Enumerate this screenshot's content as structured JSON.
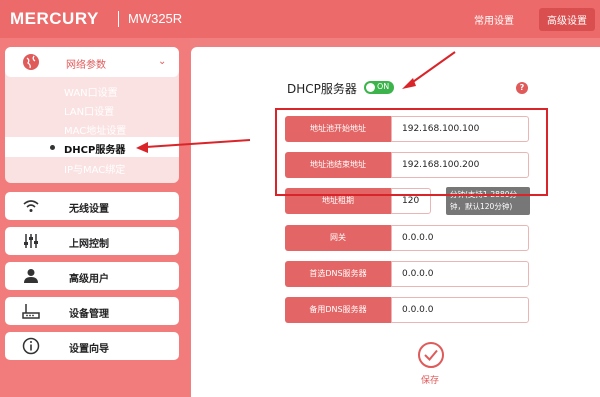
{
  "header": {
    "brand": "MERCURY",
    "model": "MW325R",
    "link_common": "常用设置",
    "link_advanced": "高级设置"
  },
  "sidebar": {
    "group": {
      "label": "网络参数",
      "icon": "globe-icon"
    },
    "sub_items": [
      "WAN口设置",
      "LAN口设置",
      "MAC地址设置",
      "DHCP服务器",
      "IP与MAC绑定"
    ],
    "active_sub": "DHCP服务器",
    "items": [
      {
        "label": "无线设置",
        "icon": "wifi-icon"
      },
      {
        "label": "上网控制",
        "icon": "sliders-icon"
      },
      {
        "label": "高级用户",
        "icon": "user-icon"
      },
      {
        "label": "设备管理",
        "icon": "router-icon"
      },
      {
        "label": "设置向导",
        "icon": "info-icon"
      }
    ]
  },
  "main": {
    "title": "DHCP服务器",
    "toggle": "ON",
    "help": "?",
    "fields": [
      {
        "label": "地址池开始地址",
        "value": "192.168.100.100"
      },
      {
        "label": "地址池结束地址",
        "value": "192.168.100.200"
      },
      {
        "label": "地址租期",
        "value": "120"
      },
      {
        "label": "网关",
        "value": "0.0.0.0"
      },
      {
        "label": "首选DNS服务器",
        "value": "0.0.0.0"
      },
      {
        "label": "备用DNS服务器",
        "value": "0.0.0.0"
      }
    ],
    "lease_hint": "分钟(支持1-2880分钟，默认120分钟)",
    "save_label": "保存"
  },
  "colors": {
    "brand": "#ec6a6a",
    "accent": "#e05a5a",
    "highlight_box": "#d9252a",
    "toggle_on": "#3cb44b"
  }
}
